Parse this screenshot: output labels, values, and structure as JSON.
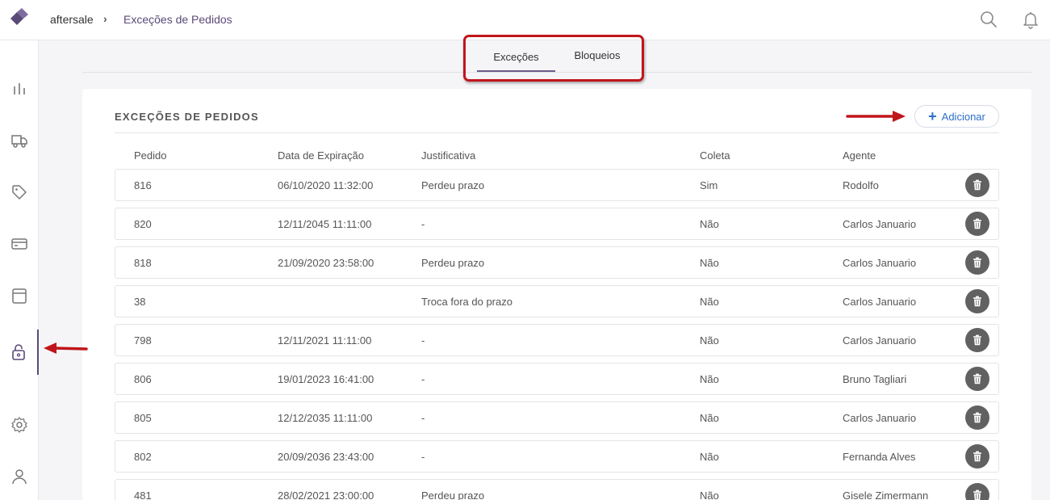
{
  "header": {
    "breadcrumb_root": "aftersale",
    "breadcrumb_separator": "›",
    "breadcrumb_current": "Exceções de Pedidos"
  },
  "tabs": [
    {
      "label": "Exceções",
      "active": true
    },
    {
      "label": "Bloqueios",
      "active": false
    }
  ],
  "card": {
    "title": "EXCEÇÕES DE PEDIDOS",
    "add_label": "Adicionar"
  },
  "table": {
    "columns": [
      "Pedido",
      "Data de Expiração",
      "Justificativa",
      "Coleta",
      "Agente"
    ],
    "rows": [
      [
        "816",
        "06/10/2020 11:32:00",
        "Perdeu prazo",
        "Sim",
        "Rodolfo"
      ],
      [
        "820",
        "12/11/2045 11:11:00",
        "-",
        "Não",
        "Carlos Januario"
      ],
      [
        "818",
        "21/09/2020 23:58:00",
        "Perdeu prazo",
        "Não",
        "Carlos Januario"
      ],
      [
        "38",
        "",
        "Troca fora do prazo",
        "Não",
        "Carlos Januario"
      ],
      [
        "798",
        "12/11/2021 11:11:00",
        "-",
        "Não",
        "Carlos Januario"
      ],
      [
        "806",
        "19/01/2023 16:41:00",
        "-",
        "Não",
        "Bruno Tagliari"
      ],
      [
        "805",
        "12/12/2035 11:11:00",
        "-",
        "Não",
        "Carlos Januario"
      ],
      [
        "802",
        "20/09/2036 23:43:00",
        "-",
        "Não",
        "Fernanda Alves"
      ],
      [
        "481",
        "28/02/2021 23:00:00",
        "Perdeu prazo",
        "Não",
        "Gisele Zimermann"
      ]
    ]
  },
  "sidebar": {
    "items": [
      {
        "icon": "bar-chart-icon",
        "active": false
      },
      {
        "icon": "truck-icon",
        "active": false
      },
      {
        "icon": "tag-icon",
        "active": false
      },
      {
        "icon": "credit-card-icon",
        "active": false
      },
      {
        "icon": "box-icon",
        "active": false
      },
      {
        "icon": "unlock-icon",
        "active": true
      },
      {
        "icon": "gear-icon",
        "active": false
      },
      {
        "icon": "user-icon",
        "active": false
      }
    ]
  },
  "colors": {
    "accent": "#5a4a78",
    "link_blue": "#2d6fc7",
    "annotation_red": "#c0161b",
    "delete_button": "#616161"
  }
}
